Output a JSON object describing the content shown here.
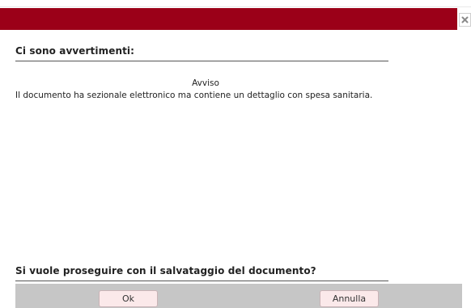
{
  "dialog": {
    "title_color": "#9b0018",
    "close_icon": "close-icon",
    "warnings_header": "Ci sono avvertimenti:",
    "message_title": "Avviso",
    "message_text": "Il documento ha sezionale elettronico ma contiene un dettaglio con spesa sanitaria.",
    "question": "Si vuole proseguire con il salvataggio del documento?",
    "buttons": {
      "ok_label": "Ok",
      "cancel_label": "Annulla"
    }
  }
}
